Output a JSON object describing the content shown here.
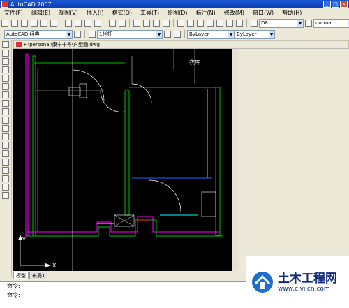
{
  "window": {
    "title": "AutoCAD 2007",
    "buttons": {
      "min": "_",
      "max": "□",
      "close": "×"
    }
  },
  "menu": [
    "文件(F)",
    "编辑(E)",
    "视图(V)",
    "插入(I)",
    "格式(O)",
    "工具(T)",
    "绘图(D)",
    "标注(N)",
    "修改(M)",
    "窗口(W)",
    "帮助(H)"
  ],
  "toolbar2": {
    "text_style": "D8",
    "dim_style": "normal"
  },
  "toolbar3": {
    "workspace": "AutoCAD 经典",
    "layer": "1栏杆",
    "color": "ByLayer",
    "linetype": "ByLayer"
  },
  "drawing": {
    "file_title": "F:\\personal\\康宁十号\\户型图.dwg",
    "room_label": "衣库",
    "axis_y": "Y",
    "axis_x": "X"
  },
  "tabs": [
    "模型",
    "布局1"
  ],
  "command": {
    "line1": "命令:",
    "line2": "命令:"
  },
  "watermark": {
    "brand": "土木工程网",
    "url": "www.civilcn.com"
  },
  "colors": {
    "canvas_bg": "#000000",
    "wall_green": "#00c000",
    "wall_magenta": "#ff00ff",
    "blue_line": "#2060ff",
    "window_cyan": "#00ffff"
  }
}
